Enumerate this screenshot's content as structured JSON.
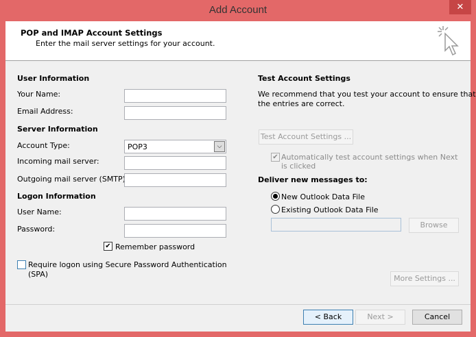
{
  "window": {
    "title": "Add Account",
    "close": "✕"
  },
  "header": {
    "title": "POP and IMAP Account Settings",
    "subtitle": "Enter the mail server settings for your account.",
    "icon": "cursor-click-icon"
  },
  "user_info": {
    "heading": "User Information",
    "name_label": "Your Name:",
    "name_value": "",
    "email_label": "Email Address:",
    "email_value": ""
  },
  "server_info": {
    "heading": "Server Information",
    "account_type_label": "Account Type:",
    "account_type_value": "POP3",
    "incoming_label": "Incoming mail server:",
    "incoming_value": "",
    "outgoing_label": "Outgoing mail server (SMTP):",
    "outgoing_value": ""
  },
  "logon_info": {
    "heading": "Logon Information",
    "username_label": "User Name:",
    "username_value": "",
    "password_label": "Password:",
    "password_value": "",
    "remember_label": "Remember password",
    "remember_checked": true,
    "spa_label": "Require logon using Secure Password Authentication",
    "spa_label2": "(SPA)",
    "spa_checked": false
  },
  "test": {
    "heading": "Test Account Settings",
    "desc1": "We recommend that you test your account to ensure that",
    "desc2": "the entries are correct.",
    "button": "Test Account Settings ...",
    "auto_label1": "Automatically test account settings when Next",
    "auto_label2": "is clicked",
    "auto_checked": true
  },
  "deliver": {
    "heading": "Deliver new messages to:",
    "new_label": "New Outlook Data File",
    "existing_label": "Existing Outlook Data File",
    "selected": "new",
    "path_value": "",
    "browse": "Browse"
  },
  "more_settings": "More Settings ...",
  "footer": {
    "back": "< Back",
    "next": "Next >",
    "cancel": "Cancel"
  }
}
